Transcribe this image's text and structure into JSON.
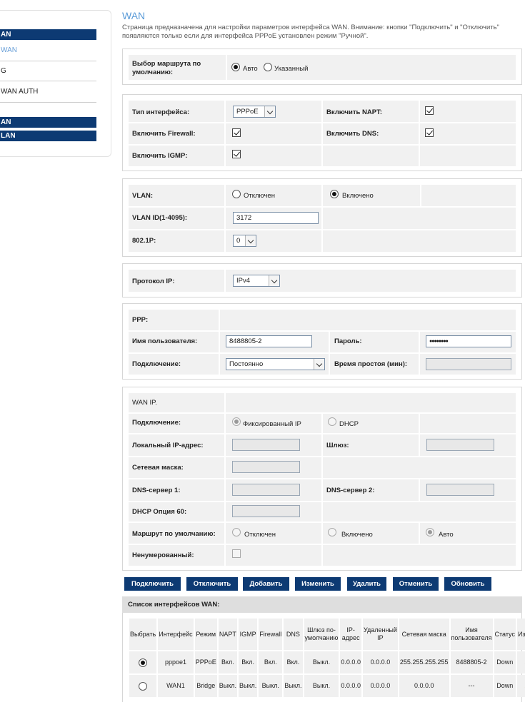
{
  "sidebar": {
    "items": [
      {
        "label": "AN",
        "style": "blue"
      },
      {
        "label": "WAN",
        "style": "active"
      },
      {
        "label": "G",
        "style": "link"
      },
      {
        "label": "WAN AUTH",
        "style": "link"
      },
      {
        "label": "AN",
        "style": "blue"
      },
      {
        "label": "LAN",
        "style": "blue"
      }
    ]
  },
  "page": {
    "title": "WAN",
    "description": "Страница предназначена для настройки параметров интерфейса WAN. Внимание: кнопки \"Подключить\" и \"Отключить\" появляются только если для интерфейса PPPoE установлен режим \"Ручной\"."
  },
  "route": {
    "label": "Выбор маршрута по умолчанию:",
    "opt_auto": "Авто",
    "opt_specified": "Указанный",
    "selected": "auto"
  },
  "iface": {
    "type_label": "Тип интерфейса:",
    "type_value": "PPPoE",
    "napt_label": "Включить NAPT:",
    "napt": true,
    "firewall_label": "Включить Firewall:",
    "firewall": true,
    "dns_label": "Включить DNS:",
    "dns": true,
    "igmp_label": "Включить IGMP:",
    "igmp": true
  },
  "vlan": {
    "label": "VLAN:",
    "opt_off": "Отключен",
    "opt_on": "Включено",
    "selected": "on",
    "id_label": "VLAN ID(1-4095):",
    "id_value": "3172",
    "p_label": "802.1P:",
    "p_value": "0"
  },
  "proto": {
    "label": "Протокол IP:",
    "value": "IPv4"
  },
  "ppp": {
    "title": "PPP:",
    "user_label": "Имя пользователя:",
    "user_value": "8488805-2",
    "pass_label": "Пароль:",
    "pass_value": "●●●●●●●●",
    "conn_label": "Подключение:",
    "conn_value": "Постоянно",
    "idle_label": "Время простоя (мин):",
    "idle_value": ""
  },
  "wanip": {
    "title": "WAN IP.",
    "conn_label": "Подключение:",
    "opt_fixed": "Фиксированный IP",
    "opt_dhcp": "DHCP",
    "local_label": "Локальный IP-адрес:",
    "gw_label": "Шлюз:",
    "mask_label": "Сетевая маска:",
    "dns1_label": "DNS-сервер 1:",
    "dns2_label": "DNS-сервер 2:",
    "dhcp60_label": "DHCP Опция 60:",
    "route_label": "Маршрут по умолчанию:",
    "route_off": "Отключен",
    "route_on": "Включено",
    "route_auto": "Авто",
    "unnum_label": "Ненумерованный:"
  },
  "buttons": {
    "connect": "Подключить",
    "disconnect": "Отключить",
    "add": "Добавить",
    "modify": "Изменить",
    "delete": "Удалить",
    "cancel": "Отменить",
    "refresh": "Обновить"
  },
  "wan_list": {
    "title": "Список интерфейсов WAN:",
    "columns": {
      "select": "Выбрать",
      "iface": "Интерфейс",
      "mode": "Режим",
      "napt": "NAPT",
      "igmp": "IGMP",
      "firewall": "Firewall",
      "dns": "DNS",
      "gw_default": "Шлюз по-умолчанию",
      "ip": "IP-адрес",
      "remote_ip": "Удаленный IP",
      "mask": "Сетевая маска",
      "user": "Имя пользователя",
      "status": "Статус",
      "edit": "Изменить"
    },
    "rows": [
      {
        "selected": true,
        "iface": "pppoe1",
        "mode": "PPPoE",
        "napt": "Вкл.",
        "igmp": "Вкл.",
        "firewall": "Вкл.",
        "dns": "Вкл.",
        "gw": "Выкл.",
        "ip": "0.0.0.0",
        "remote": "0.0.0.0",
        "mask": "255.255.255.255",
        "user": "8488805-2",
        "status": "Down"
      },
      {
        "selected": false,
        "iface": "WAN1",
        "mode": "Bridge",
        "napt": "Выкл.",
        "igmp": "Выкл.",
        "firewall": "Выкл.",
        "dns": "Выкл.",
        "gw": "Выкл.",
        "ip": "0.0.0.0",
        "remote": "0.0.0.0",
        "mask": "0.0.0.0",
        "user": "---",
        "status": "Down"
      }
    ]
  },
  "colors": {
    "accent": "#0d3a73",
    "title": "#5a9bd8",
    "cell": "#f1f1f1"
  }
}
